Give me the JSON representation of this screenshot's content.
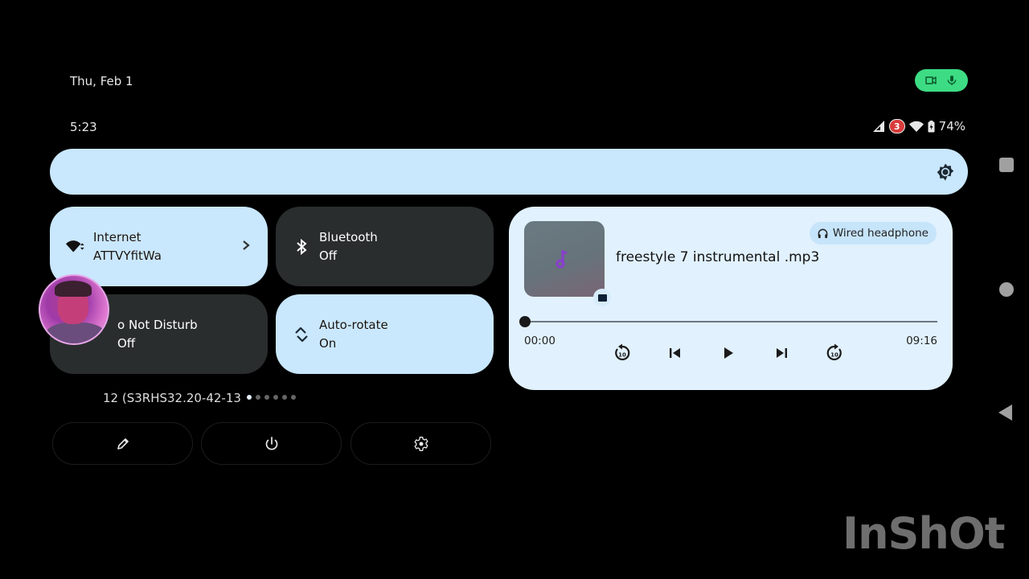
{
  "header": {
    "date": "Thu, Feb 1",
    "time": "5:23",
    "privacy_indicators": [
      "camera-icon",
      "microphone-icon"
    ],
    "privacy_color": "#3ddc84"
  },
  "status_bar": {
    "icons": [
      "cellular-signal-icon",
      "notification-count-badge",
      "wifi-icon",
      "battery-charging-icon"
    ],
    "notification_count": "3",
    "battery": "74%"
  },
  "brightness": {
    "icon": "brightness-icon",
    "level": 1.0,
    "color": "#c9e7fd"
  },
  "tiles": [
    {
      "id": "internet",
      "label": "Internet",
      "state": "ATTVYfitWa",
      "active": true,
      "icon": "wifi-icon",
      "has_chevron": true
    },
    {
      "id": "bluetooth",
      "label": "Bluetooth",
      "state": "Off",
      "active": false,
      "icon": "bluetooth-icon"
    },
    {
      "id": "dnd",
      "label": "Do Not Disturb",
      "visible_label": "o Not Disturb",
      "state": "Off",
      "active": false,
      "icon": "do-not-disturb-icon"
    },
    {
      "id": "autorotate",
      "label": "Auto-rotate",
      "state": "On",
      "active": true,
      "icon": "rotate-icon"
    }
  ],
  "build_number": "12 (S3RHS32.20-42-13",
  "pager": {
    "pages": 6,
    "current": 1
  },
  "footer_buttons": [
    {
      "id": "edit",
      "icon": "pencil-icon"
    },
    {
      "id": "power",
      "icon": "power-icon"
    },
    {
      "id": "settings",
      "icon": "gear-icon"
    }
  ],
  "media": {
    "title": "freestyle 7 instrumental .mp3",
    "output_device": "Wired headphone",
    "elapsed": "00:00",
    "duration": "09:16",
    "progress": 0.0,
    "controls": [
      "replay-10-icon",
      "skip-previous-icon",
      "play-icon",
      "skip-next-icon",
      "forward-10-icon"
    ],
    "replay_seconds": "10",
    "forward_seconds": "10"
  },
  "navigation": [
    "recents-button",
    "home-button",
    "back-button"
  ],
  "watermark": "InShOt"
}
